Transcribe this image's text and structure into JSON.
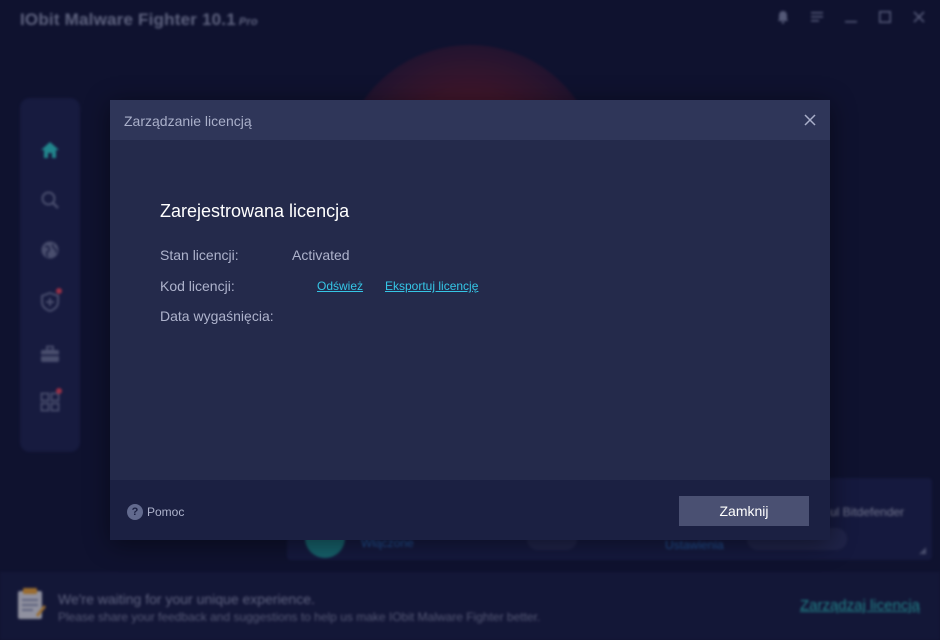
{
  "app": {
    "title": "IObit Malware Fighter 10.1",
    "edition": "Pro",
    "window_controls": [
      "bell-icon",
      "menu-icon",
      "minimize-icon",
      "maximize-icon",
      "close-icon"
    ]
  },
  "sidebar": {
    "items": [
      {
        "icon": "home-icon",
        "active": true
      },
      {
        "icon": "search-icon"
      },
      {
        "icon": "globe-icon"
      },
      {
        "icon": "shield-plus-icon",
        "badge": true
      },
      {
        "icon": "toolbox-icon"
      },
      {
        "icon": "apps-grid-icon",
        "badge": true
      }
    ]
  },
  "background_panel": {
    "partial_label": "ul Bitdefender",
    "partial_left_text": "Włączone",
    "partial_link": "Ustawienia"
  },
  "footer": {
    "line1": "We're waiting for your unique experience.",
    "line2": "Please share your feedback and suggestions to help us make IObit Malware Fighter better.",
    "manage_link": "Zarządzaj licencją"
  },
  "dialog": {
    "title": "Zarządzanie licencją",
    "section_title": "Zarejestrowana licencja",
    "rows": {
      "status_label": "Stan licencji:",
      "status_value": "Activated",
      "code_label": "Kod licencji:",
      "expiry_label": "Data wygaśnięcia:"
    },
    "links": {
      "refresh": "Odśwież",
      "export": "Eksportuj licencję"
    },
    "help_label": "Pomoc",
    "close_button": "Zamknij"
  },
  "colors": {
    "background": "#13183a",
    "dialog_body": "#242a4b",
    "dialog_header": "#2f3659",
    "dialog_footer": "#1b2042",
    "link": "#35c6e6",
    "accent_teal": "#2ec3c3",
    "badge_red": "#e5455c"
  }
}
